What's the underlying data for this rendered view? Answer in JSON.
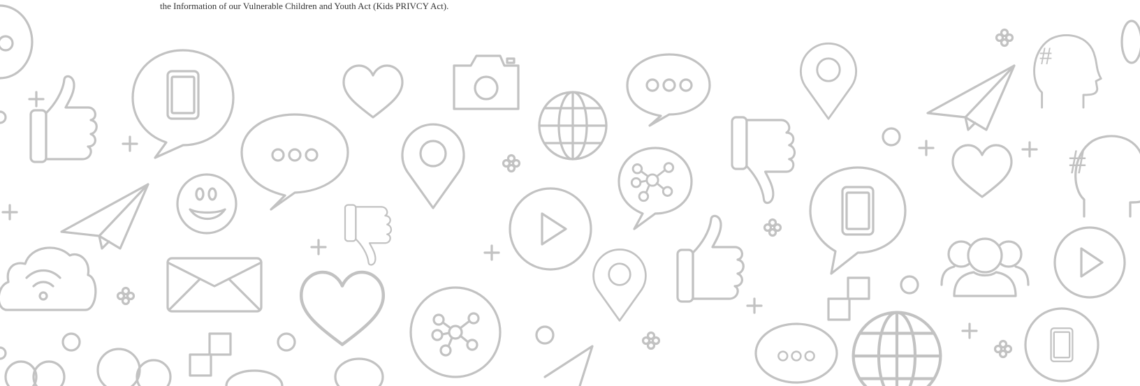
{
  "caption": "the Information of our Vulnerable Children and Youth Act (Kids PRIVCY Act).",
  "pattern": {
    "stroke_color": "#c2c2c2",
    "background_color": "#ffffff",
    "icons": [
      "speech-bubble-icon",
      "phone-icon",
      "thumbs-up-icon",
      "thumbs-down-icon",
      "paper-plane-icon",
      "smiley-icon",
      "cloud-wifi-icon",
      "envelope-icon",
      "heart-icon",
      "camera-icon",
      "location-pin-icon",
      "globe-icon",
      "play-icon",
      "network-icon",
      "hashtag-head-icon",
      "users-icon",
      "plus-icon",
      "circle-icon",
      "squares-icon"
    ]
  }
}
